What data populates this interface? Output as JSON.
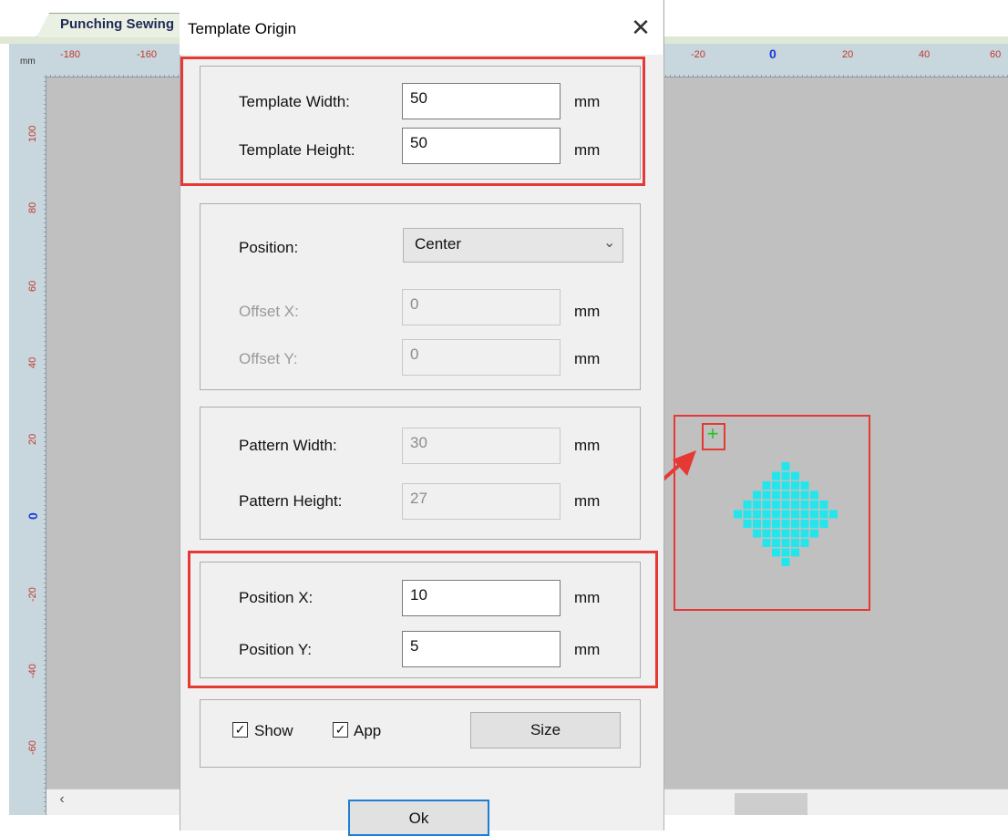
{
  "tab": {
    "label": "Punching Sewing"
  },
  "ruler": {
    "unit": "mm",
    "h_ticks": [
      "-180",
      "-160",
      "-20",
      "0",
      "20",
      "40",
      "60"
    ],
    "v_ticks": [
      "100",
      "80",
      "60",
      "40",
      "20",
      "0",
      "-20",
      "-40",
      "-60"
    ]
  },
  "dialog": {
    "title": "Template Origin",
    "close_glyph": "✕",
    "template": {
      "width_label": "Template Width:",
      "width_value": "50",
      "height_label": "Template Height:",
      "height_value": "50",
      "unit": "mm"
    },
    "position": {
      "label": "Position:",
      "selected": "Center",
      "offset_x_label": "Offset X:",
      "offset_x_value": "0",
      "offset_y_label": "Offset Y:",
      "offset_y_value": "0",
      "unit": "mm"
    },
    "pattern": {
      "width_label": "Pattern Width:",
      "width_value": "30",
      "height_label": "Pattern Height:",
      "height_value": "27",
      "unit": "mm"
    },
    "pos": {
      "x_label": "Position X:",
      "x_value": "10",
      "y_label": "Position Y:",
      "y_value": "5",
      "unit": "mm"
    },
    "options": {
      "show_label": "Show",
      "show_checked": true,
      "app_label": "App",
      "app_checked": true,
      "size_button": "Size"
    },
    "ok_button": "Ok"
  },
  "icons": {
    "scroll_left": "‹",
    "origin_marker": "+",
    "checkmark": "✓",
    "chevron": "⌄"
  },
  "colors": {
    "highlight": "#e53935",
    "pattern": "#23e6ec",
    "origin_marker": "#27c427",
    "ruler_tick": "#c0392b",
    "ruler_zero": "#1d3bd8"
  }
}
